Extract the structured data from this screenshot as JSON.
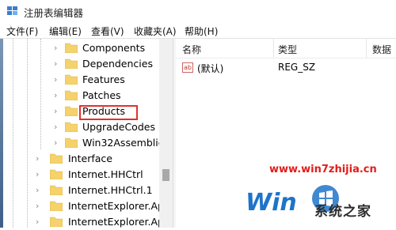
{
  "window": {
    "title": "注册表编辑器"
  },
  "menu": [
    "文件(F)",
    "编辑(E)",
    "查看(V)",
    "收藏夹(A)",
    "帮助(H)"
  ],
  "tree": {
    "children_expanded": [
      "Components",
      "Dependencies",
      "Features",
      "Patches",
      "Products",
      "UpgradeCodes",
      "Win32Assemblie"
    ],
    "siblings": [
      "Interface",
      "Internet.HHCtrl",
      "Internet.HHCtrl.1",
      "InternetExplorer.Ap",
      "InternetExplorer.Ap"
    ],
    "highlighted": "Products"
  },
  "columns": [
    "名称",
    "类型",
    "数据"
  ],
  "values": [
    {
      "name": "(默认)",
      "type": "REG_SZ",
      "icon": "ab-string-icon"
    }
  ],
  "watermark": {
    "url": "www.win7zhijia.cn",
    "site": "系统之家"
  },
  "colors": {
    "highlight": "#e0312d",
    "folder": "#f5d26b",
    "watermark_red": "#e41b17",
    "watermark_blue": "#1e74c9"
  }
}
